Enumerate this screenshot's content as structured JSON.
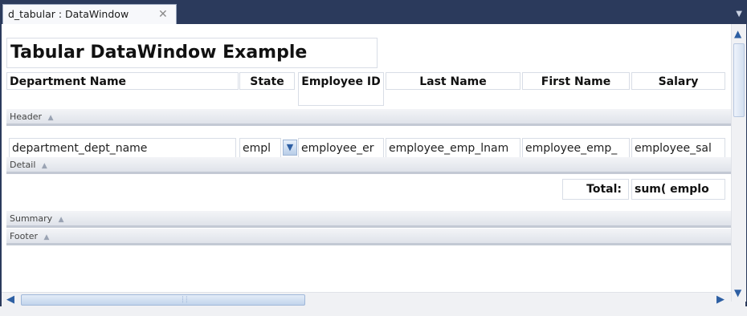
{
  "tab": {
    "title": "d_tabular : DataWindow",
    "close": "✕"
  },
  "report": {
    "title": "Tabular DataWindow Example",
    "headers": [
      "Department Name",
      "State",
      "Employee ID",
      "Last Name",
      "First Name",
      "Salary"
    ],
    "columns": [
      "department_dept_name",
      "empl",
      "employee_er",
      "employee_emp_lnam",
      "employee_emp_",
      "employee_sal"
    ],
    "total_label": "Total:",
    "total_value": "sum( emplo"
  },
  "bands": {
    "header": "Header",
    "detail": "Detail",
    "summary": "Summary",
    "footer": "Footer"
  },
  "icons": {
    "band_arrow": "▲",
    "dropdown": "▼",
    "scroll_up": "▲",
    "scroll_down": "▼",
    "scroll_left": "◀",
    "scroll_right": "▶",
    "tab_menu": "▼"
  }
}
